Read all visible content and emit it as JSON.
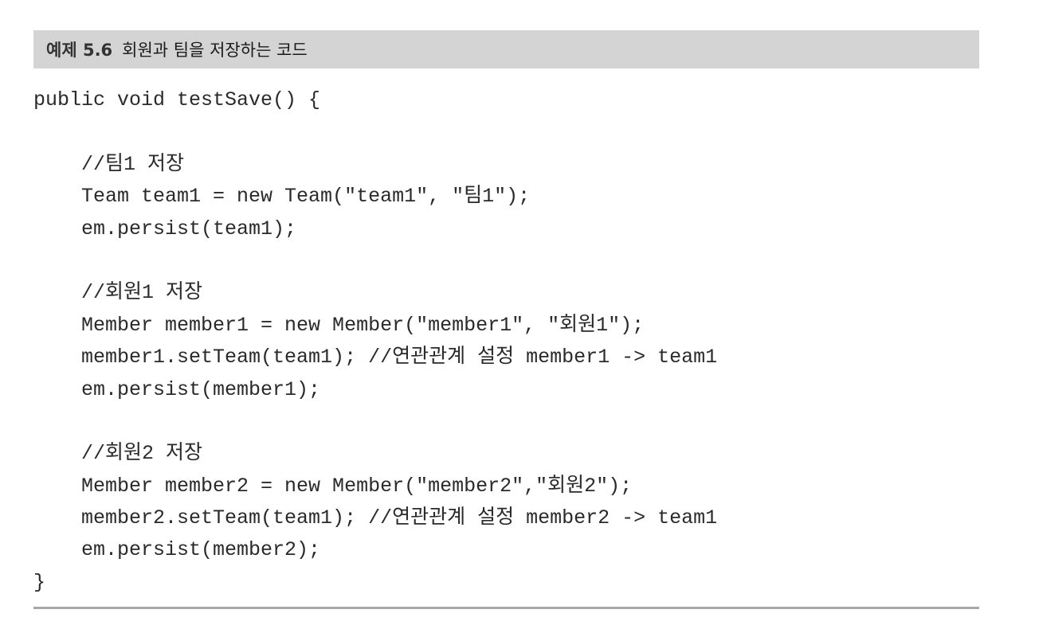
{
  "caption": {
    "label": "예제 5.6",
    "title": "회원과 팀을 저장하는 코드"
  },
  "code_lines": [
    "public void testSave() {",
    "",
    "    //팀1 저장",
    "    Team team1 = new Team(\"team1\", \"팀1\");",
    "    em.persist(team1);",
    "",
    "    //회원1 저장",
    "    Member member1 = new Member(\"member1\", \"회원1\");",
    "    member1.setTeam(team1); //연관관계 설정 member1 -> team1",
    "    em.persist(member1);",
    "",
    "    //회원2 저장",
    "    Member member2 = new Member(\"member2\",\"회원2\");",
    "    member2.setTeam(team1); //연관관계 설정 member2 -> team1",
    "    em.persist(member2);",
    "}"
  ]
}
